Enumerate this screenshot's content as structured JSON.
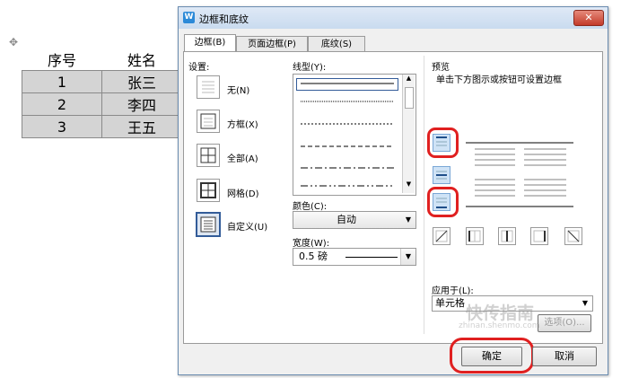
{
  "document": {
    "headers": [
      "序号",
      "姓名"
    ],
    "rows": [
      [
        "1",
        "张三"
      ],
      [
        "2",
        "李四"
      ],
      [
        "3",
        "王五"
      ]
    ]
  },
  "dialog": {
    "title": "边框和底纹",
    "close": "✕",
    "tabs": [
      "边框(B)",
      "页面边框(P)",
      "底纹(S)"
    ],
    "settings": {
      "label": "设置:",
      "items": [
        "无(N)",
        "方框(X)",
        "全部(A)",
        "网格(D)",
        "自定义(U)"
      ]
    },
    "line_style": {
      "label": "线型(Y):"
    },
    "color": {
      "label": "颜色(C):",
      "value": "自动"
    },
    "width": {
      "label": "宽度(W):",
      "value": "0.5 磅"
    },
    "preview": {
      "label": "预览",
      "hint": "单击下方图示或按钮可设置边框"
    },
    "apply_to": {
      "label": "应用于(L):",
      "value": "单元格"
    },
    "options_label": "选项(O)...",
    "ok_label": "确定",
    "cancel_label": "取消"
  },
  "colors": {
    "accent": "#2c8ad8",
    "highlight": "#e02020",
    "table_fill": "#d4d4d4"
  },
  "watermark": {
    "text": "快传指南",
    "url": "zhinan.shenmo.com"
  }
}
